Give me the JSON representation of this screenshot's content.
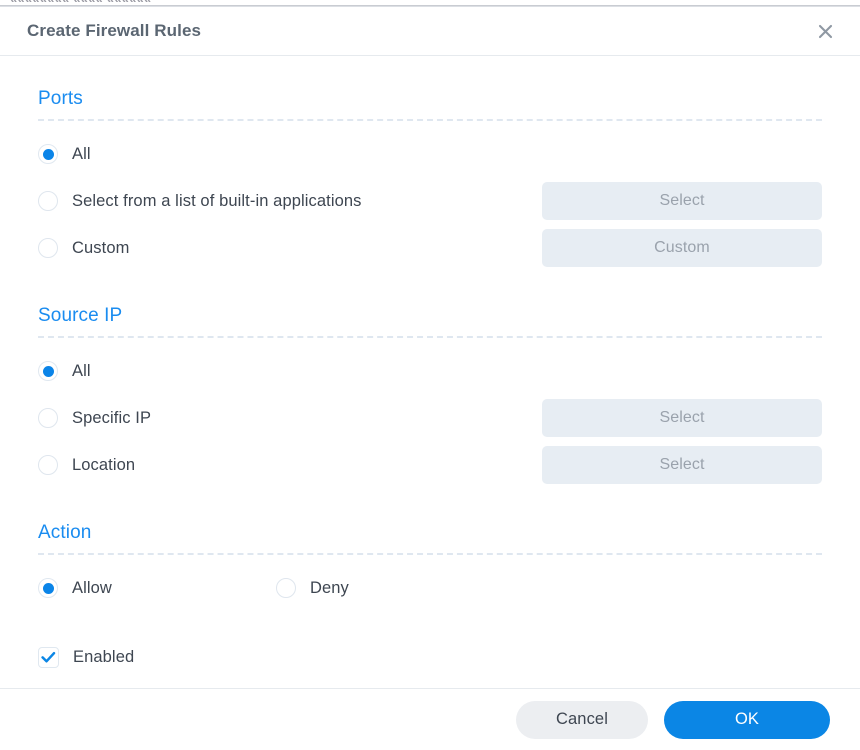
{
  "background": {
    "peek_text": "«««««««« «««« ««««««"
  },
  "dialog": {
    "title": "Create Firewall Rules",
    "close_icon": "close-icon"
  },
  "sections": {
    "ports": {
      "title": "Ports",
      "options": [
        {
          "label": "All",
          "selected": true,
          "button": null
        },
        {
          "label": "Select from a list of built-in applications",
          "selected": false,
          "button": "Select"
        },
        {
          "label": "Custom",
          "selected": false,
          "button": "Custom"
        }
      ]
    },
    "source_ip": {
      "title": "Source IP",
      "options": [
        {
          "label": "All",
          "selected": true,
          "button": null
        },
        {
          "label": "Specific IP",
          "selected": false,
          "button": "Select"
        },
        {
          "label": "Location",
          "selected": false,
          "button": "Select"
        }
      ]
    },
    "action": {
      "title": "Action",
      "options": [
        {
          "label": "Allow",
          "selected": true
        },
        {
          "label": "Deny",
          "selected": false
        }
      ],
      "enabled_checkbox": {
        "label": "Enabled",
        "checked": true
      }
    }
  },
  "footer": {
    "cancel_label": "Cancel",
    "ok_label": "OK"
  },
  "colors": {
    "accent_blue": "#1a8cf0",
    "primary_button": "#0b86e5",
    "radio_dot": "#0a84e8",
    "title_text": "#5b6672",
    "label_text": "#3e4651",
    "disabled_button_bg": "#e7edf3",
    "disabled_button_text": "#9aa2ac"
  }
}
